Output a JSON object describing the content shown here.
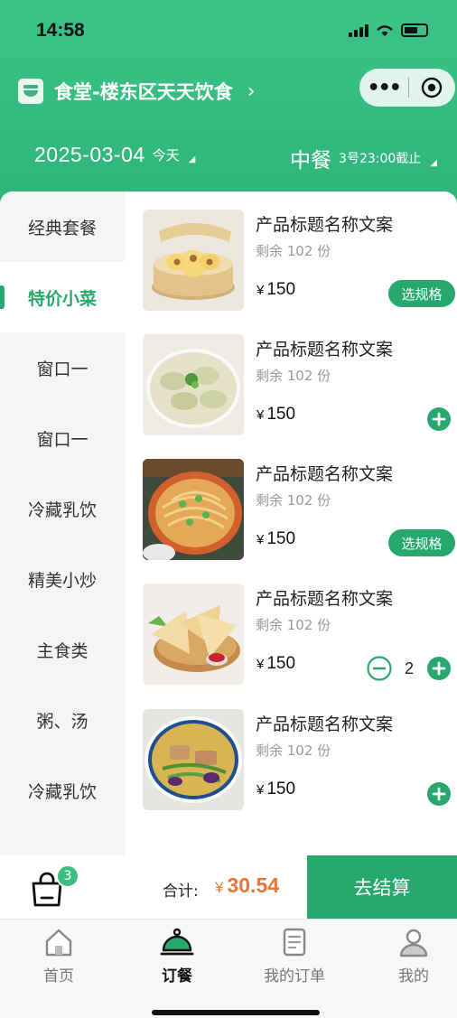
{
  "status_bar": {
    "time": "14:58"
  },
  "header": {
    "store_name": "食堂-楼东区天天饮食",
    "store_arrow": "›",
    "capsule_dots": "•••",
    "date": "2025-03-04",
    "date_note": "今天",
    "meal": "中餐",
    "deadline": "3号23:00截止",
    "dropdown_glyph": "◢",
    "colors": {
      "brand": "#2fb578",
      "accent": "#27a86d",
      "price": "#e8763a"
    }
  },
  "sidebar": {
    "items": [
      "经典套餐",
      "特价小菜",
      "窗口一",
      "窗口一",
      "冷藏乳饮",
      "精美小炒",
      "主食类",
      "粥、汤",
      "冷藏乳饮"
    ],
    "active_index": 1
  },
  "products": [
    {
      "title": "产品标题名称文案",
      "stock": "剩余 102 份",
      "currency": "¥",
      "price": "150",
      "action": "spec",
      "action_label": "选规格",
      "image": "steamed-buns"
    },
    {
      "title": "产品标题名称文案",
      "stock": "剩余 102 份",
      "currency": "¥",
      "price": "150",
      "action": "add",
      "image": "dumplings"
    },
    {
      "title": "产品标题名称文案",
      "stock": "剩余 102 份",
      "currency": "¥",
      "price": "150",
      "action": "spec",
      "action_label": "选规格",
      "image": "noodles"
    },
    {
      "title": "产品标题名称文案",
      "stock": "剩余 102 份",
      "currency": "¥",
      "price": "150",
      "action": "stepper",
      "quantity": "2",
      "image": "samosas"
    },
    {
      "title": "产品标题名称文案",
      "stock": "剩余 102 份",
      "currency": "¥",
      "price": "150",
      "action": "add",
      "image": "curry"
    }
  ],
  "cart": {
    "badge_count": "3",
    "total_label": "合计:",
    "currency": "¥",
    "total_value": "30.54",
    "checkout_label": "去结算"
  },
  "tabbar": {
    "items": [
      {
        "label": "首页",
        "icon": "home-icon"
      },
      {
        "label": "订餐",
        "icon": "cloche-icon"
      },
      {
        "label": "我的订单",
        "icon": "order-list-icon"
      },
      {
        "label": "我的",
        "icon": "user-icon"
      }
    ],
    "active_index": 1
  }
}
